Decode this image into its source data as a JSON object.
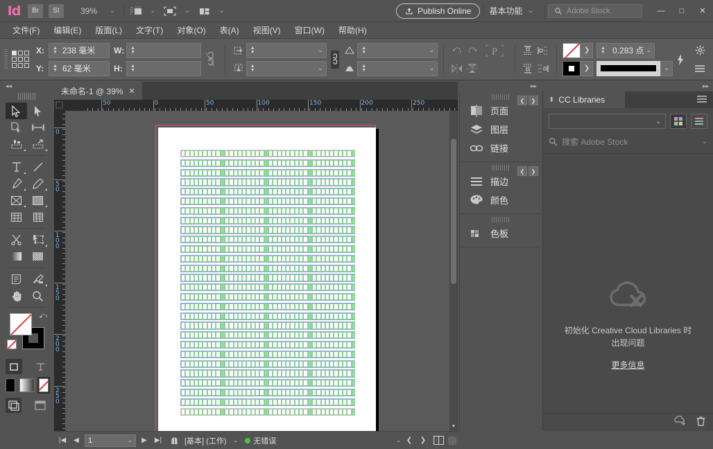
{
  "app": {
    "logo": "Id",
    "bridge_label": "Br",
    "stock_label": "St",
    "zoom_level": "39%"
  },
  "titlebar": {
    "publish_label": "Publish Online",
    "workspace": "基本功能",
    "stock_placeholder": "Adobe Stock",
    "minimize": "—",
    "maximize": "□",
    "close": "✕",
    "view_icons": [
      "screen-mode-icon",
      "view-options-icon",
      "arrange-documents-icon"
    ]
  },
  "menubar": {
    "items": [
      {
        "label": "文件(F)"
      },
      {
        "label": "编辑(E)"
      },
      {
        "label": "版面(L)"
      },
      {
        "label": "文字(T)"
      },
      {
        "label": "对象(O)"
      },
      {
        "label": "表(A)"
      },
      {
        "label": "视图(V)"
      },
      {
        "label": "窗口(W)"
      },
      {
        "label": "帮助(H)"
      }
    ]
  },
  "control_panel": {
    "x_label": "X:",
    "x_value": "238 毫米",
    "y_label": "Y:",
    "y_value": "62 毫米",
    "w_label": "W:",
    "w_value": "",
    "h_label": "H:",
    "h_value": "",
    "scale_x_value": "",
    "scale_y_value": "",
    "rotation_value": "",
    "shear_value": "",
    "stroke_weight": "0.283 点",
    "constrain_icon": "chain-link-icon",
    "rotate_cw_icon": "rotate-clockwise-icon",
    "rotate_ccw_icon": "rotate-counterclockwise-icon",
    "flip_h_icon": "flip-horizontal-icon",
    "flip_v_icon": "flip-vertical-icon",
    "select_container_icon": "select-container-icon",
    "align_icons": [
      "align-top-icon",
      "align-left-icon",
      "align-bottom-icon",
      "align-right-icon"
    ],
    "quick_apply_icon": "quick-apply-icon",
    "panel_menu_icon": "panel-menu-icon",
    "preferences_icon": "gear-icon"
  },
  "document": {
    "tab_title": "未命名-1 @ 39%",
    "tab_close": "✕"
  },
  "rulers": {
    "horizontal_labels": [
      "50",
      "0",
      "50",
      "100",
      "150",
      "200",
      "250"
    ],
    "vertical_labels": [
      "0",
      "50",
      "100",
      "150",
      "200",
      "250"
    ],
    "units": "毫米"
  },
  "toolbox": {
    "tools": [
      {
        "name": "selection-tool",
        "selected": true
      },
      {
        "name": "direct-selection-tool",
        "selected": false
      },
      {
        "name": "page-tool",
        "selected": false
      },
      {
        "name": "gap-tool",
        "selected": false
      },
      {
        "name": "content-collector-tool",
        "selected": false
      },
      {
        "name": "content-placer-tool",
        "selected": false
      },
      {
        "name": "type-tool",
        "selected": false
      },
      {
        "name": "line-tool",
        "selected": false
      },
      {
        "name": "pen-tool",
        "selected": false
      },
      {
        "name": "pencil-tool",
        "selected": false
      },
      {
        "name": "frame-tool",
        "selected": false
      },
      {
        "name": "rectangle-tool",
        "selected": false
      },
      {
        "name": "table-tool",
        "selected": false
      },
      {
        "name": "column-tool",
        "selected": false
      },
      {
        "name": "scissors-tool",
        "selected": false
      },
      {
        "name": "free-transform-tool",
        "selected": false
      },
      {
        "name": "gradient-swatch-tool",
        "selected": false
      },
      {
        "name": "gradient-feather-tool",
        "selected": false
      },
      {
        "name": "note-tool",
        "selected": false
      },
      {
        "name": "eyedropper-tool",
        "selected": false
      },
      {
        "name": "hand-tool",
        "selected": false
      },
      {
        "name": "zoom-tool",
        "selected": false
      }
    ],
    "fill_color": "#ffffff",
    "stroke_color": "#000000",
    "none_icon": "none-swatch-icon",
    "swap_icon": "swap-fill-stroke-icon",
    "apply_formatting": [
      "format-container-icon",
      "format-text-icon"
    ],
    "apply_modes": [
      "apply-color-icon",
      "apply-gradient-icon",
      "apply-none-icon"
    ],
    "screen_modes": [
      "normal-mode-icon",
      "preview-mode-icon"
    ]
  },
  "statusbar": {
    "first_page_icon": "first-page-icon",
    "prev_page_icon": "previous-page-icon",
    "page_number": "1",
    "next_page_icon": "next-page-icon",
    "last_page_icon": "last-page-icon",
    "master_icon": "master-page-icon",
    "master_label": "[基本]  (工作)",
    "preflight_status": "无错误",
    "preflight_color": "#3ec93e"
  },
  "panel_dock": {
    "groups": [
      {
        "items": [
          {
            "label": "页面",
            "icon": "pages-icon"
          },
          {
            "label": "图层",
            "icon": "layers-icon"
          },
          {
            "label": "链接",
            "icon": "links-icon"
          }
        ]
      },
      {
        "items": [
          {
            "label": "描边",
            "icon": "stroke-icon"
          },
          {
            "label": "颜色",
            "icon": "color-icon"
          }
        ]
      },
      {
        "items": [
          {
            "label": "色板",
            "icon": "swatches-icon"
          }
        ]
      }
    ]
  },
  "cc_libraries": {
    "tab_label": "CC Libraries",
    "menu_icon": "panel-menu-icon",
    "library_select_value": "",
    "grid_view_icon": "grid-view-icon",
    "list_view_icon": "list-view-icon",
    "search_placeholder": "搜索 Adobe Stock",
    "error_message": "初始化 Creative Cloud Libraries 时出现问题",
    "more_info_label": "更多信息",
    "footer_icons": [
      "sync-icon",
      "trash-icon"
    ]
  },
  "artwork": {
    "description": "grid-of-green-cells",
    "cell_stroke_color": "#86d191",
    "cell_fill_color": "#93dd9e",
    "frame_color": "#9aa0e8",
    "bleed_color": "#e8556a",
    "rows": 28,
    "columns": 40,
    "filled_every": 10
  }
}
